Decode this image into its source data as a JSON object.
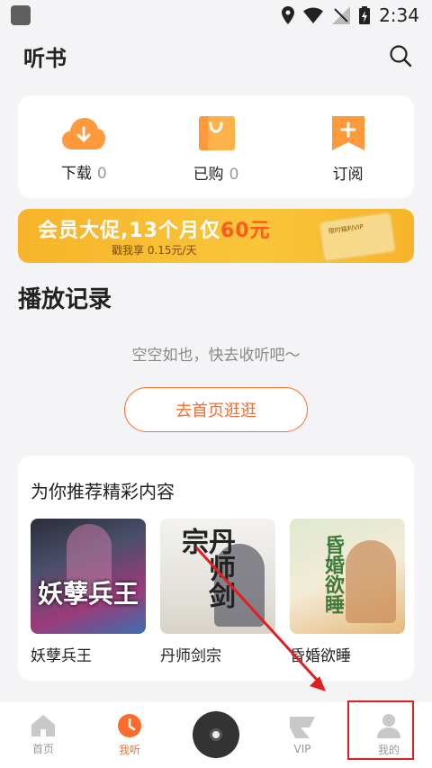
{
  "status": {
    "time": "2:34"
  },
  "header": {
    "title": "听书"
  },
  "quick_actions": [
    {
      "label": "下载",
      "count": "0",
      "icon": "cloud-download-icon"
    },
    {
      "label": "已购",
      "count": "0",
      "icon": "shopping-bag-icon"
    },
    {
      "label": "订阅",
      "count": "",
      "icon": "bookmark-plus-icon"
    }
  ],
  "banner": {
    "title_prefix": "会员大促,",
    "title_mid": "13个月仅",
    "title_price": "60元",
    "subtitle": "戳我享 0.15元/天",
    "card_text": "限时福利VIP"
  },
  "history": {
    "title": "播放记录",
    "empty_text": "空空如也，快去收听吧～",
    "button_label": "去首页逛逛"
  },
  "recommend": {
    "title": "为你推荐精彩内容",
    "items": [
      {
        "name": "妖孽兵王",
        "cover_text": "妖孽兵王"
      },
      {
        "name": "丹师剑宗",
        "cover_text": "丹师剑宗"
      },
      {
        "name": "昏婚欲睡",
        "cover_text": "昏婚欲睡"
      }
    ]
  },
  "tabbar": {
    "tabs": [
      {
        "label": "首页",
        "icon": "home-icon"
      },
      {
        "label": "我听",
        "icon": "clock-icon"
      },
      {
        "label": "",
        "icon": "disc-icon"
      },
      {
        "label": "VIP",
        "icon": "vip-icon"
      },
      {
        "label": "我的",
        "icon": "user-icon"
      }
    ]
  },
  "colors": {
    "accent": "#ff6b2b",
    "banner": "#f9c53b",
    "annotation": "#e02020"
  }
}
